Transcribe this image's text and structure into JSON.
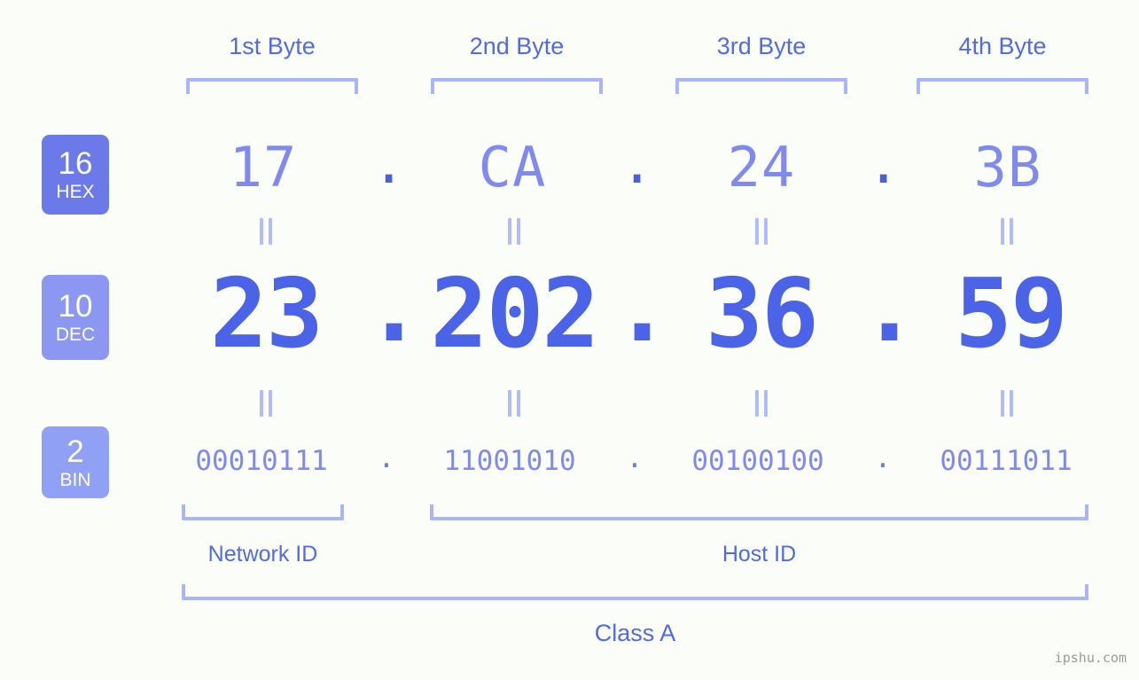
{
  "watermark": "ipshu.com",
  "colors": {
    "background": "#fbfdf8",
    "bracket": "#aab5f9",
    "label_text": "#5269e8",
    "hex_text": "#8089ee",
    "dec_text": "#4a63e7",
    "bin_text": "#8089ee",
    "badge_hex": "#6b7ae8",
    "badge_dec": "#8b97f0",
    "badge_bin": "#8fa0f5",
    "equals_mark": "#b0bbfb",
    "watermark_text": "#9a9a9a"
  },
  "byte_headers": [
    {
      "label": "1st Byte"
    },
    {
      "label": "2nd Byte"
    },
    {
      "label": "3rd Byte"
    },
    {
      "label": "4th Byte"
    }
  ],
  "rows": {
    "hex": {
      "badge_number": "16",
      "badge_name": "HEX",
      "values": [
        "17",
        "CA",
        "24",
        "3B"
      ],
      "separator": "."
    },
    "dec": {
      "badge_number": "10",
      "badge_name": "DEC",
      "values": [
        "23",
        "202",
        "36",
        "59"
      ],
      "separator": "."
    },
    "bin": {
      "badge_number": "2",
      "badge_name": "BIN",
      "values": [
        "00010111",
        "11001010",
        "00100100",
        "00111011"
      ],
      "separator": "."
    }
  },
  "equals_symbol": "||",
  "sections": {
    "network_id": "Network ID",
    "host_id": "Host ID",
    "class": "Class A"
  }
}
